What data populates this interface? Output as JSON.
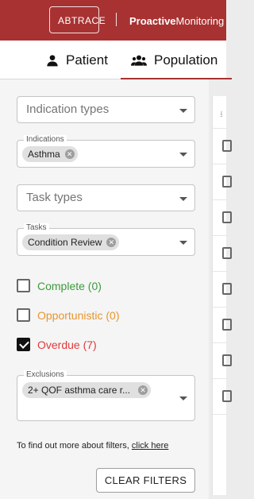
{
  "header": {
    "logo_text": "ABTRACE",
    "product_bold": "Proactive",
    "product_rest": "Monitoring",
    "background": "#a83232"
  },
  "tabs": [
    {
      "label": "Patient",
      "icon": "person-icon",
      "active": false
    },
    {
      "label": "Population",
      "icon": "group-icon",
      "active": true
    }
  ],
  "filters": {
    "indication_types": {
      "placeholder": "Indication types"
    },
    "indications": {
      "legend": "Indications",
      "chips": [
        "Asthma"
      ]
    },
    "task_types": {
      "placeholder": "Task types"
    },
    "tasks": {
      "legend": "Tasks",
      "chips": [
        "Condition Review"
      ]
    },
    "status": [
      {
        "label": "Complete (0)",
        "checked": false,
        "color": "#3c9a3c"
      },
      {
        "label": "Opportunistic (0)",
        "checked": false,
        "color": "#e8952e"
      },
      {
        "label": "Overdue (7)",
        "checked": true,
        "color": "#e03a3a"
      }
    ],
    "exclusions": {
      "legend": "Exclusions",
      "chips": [
        "2+ QOF asthma care r..."
      ]
    },
    "info_text": "To find out more about filters, ",
    "info_link": "click here",
    "clear_label": "CLEAR FILTERS"
  }
}
